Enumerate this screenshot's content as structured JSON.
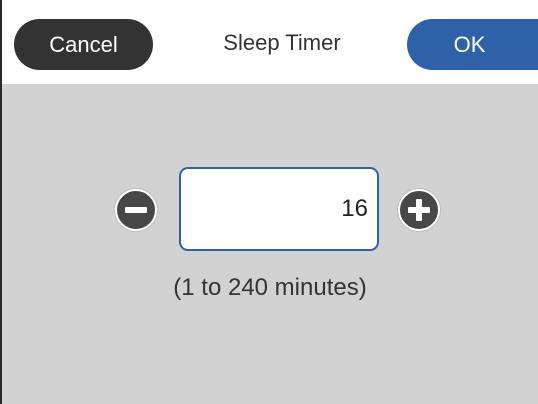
{
  "header": {
    "cancel_label": "Cancel",
    "title": "Sleep Timer",
    "ok_label": "OK"
  },
  "timer": {
    "value": "16",
    "range_hint": "(1 to 240 minutes)",
    "min_minutes": 1,
    "max_minutes": 240
  },
  "colors": {
    "accent": "#2e61a8",
    "cancel_bg": "#333333",
    "panel_bg": "#d2d2d2",
    "round_button_bg": "#474747"
  },
  "icons": {
    "decrease": "minus-icon",
    "increase": "plus-icon"
  }
}
